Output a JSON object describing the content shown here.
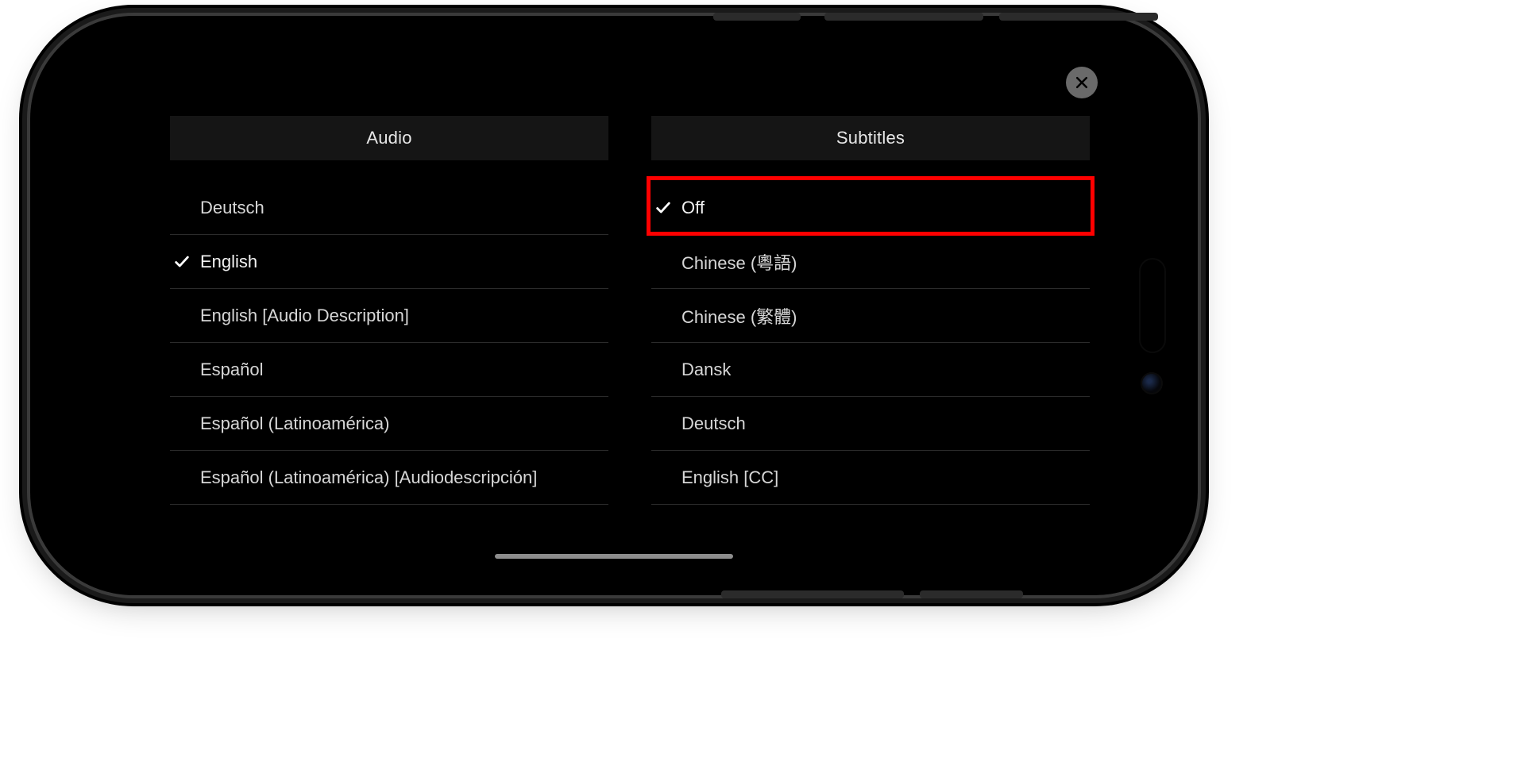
{
  "headers": {
    "audio": "Audio",
    "subtitles": "Subtitles"
  },
  "icons": {
    "close": "close-icon",
    "check": "check-icon"
  },
  "audio": {
    "selected_index": 1,
    "items": [
      {
        "label": "Deutsch"
      },
      {
        "label": "English"
      },
      {
        "label": "English [Audio Description]"
      },
      {
        "label": "Español"
      },
      {
        "label": "Español (Latinoamérica)"
      },
      {
        "label": "Español (Latinoamérica) [Audiodescripción]"
      }
    ]
  },
  "subtitles": {
    "selected_index": 0,
    "highlight_index": 0,
    "items": [
      {
        "label": "Off"
      },
      {
        "label": "Chinese (粵語)"
      },
      {
        "label": "Chinese (繁體)"
      },
      {
        "label": "Dansk"
      },
      {
        "label": "Deutsch"
      },
      {
        "label": "English [CC]"
      }
    ]
  },
  "colors": {
    "highlight": "#ff0000",
    "header_bg": "#151515",
    "text": "#d7d7d7"
  }
}
